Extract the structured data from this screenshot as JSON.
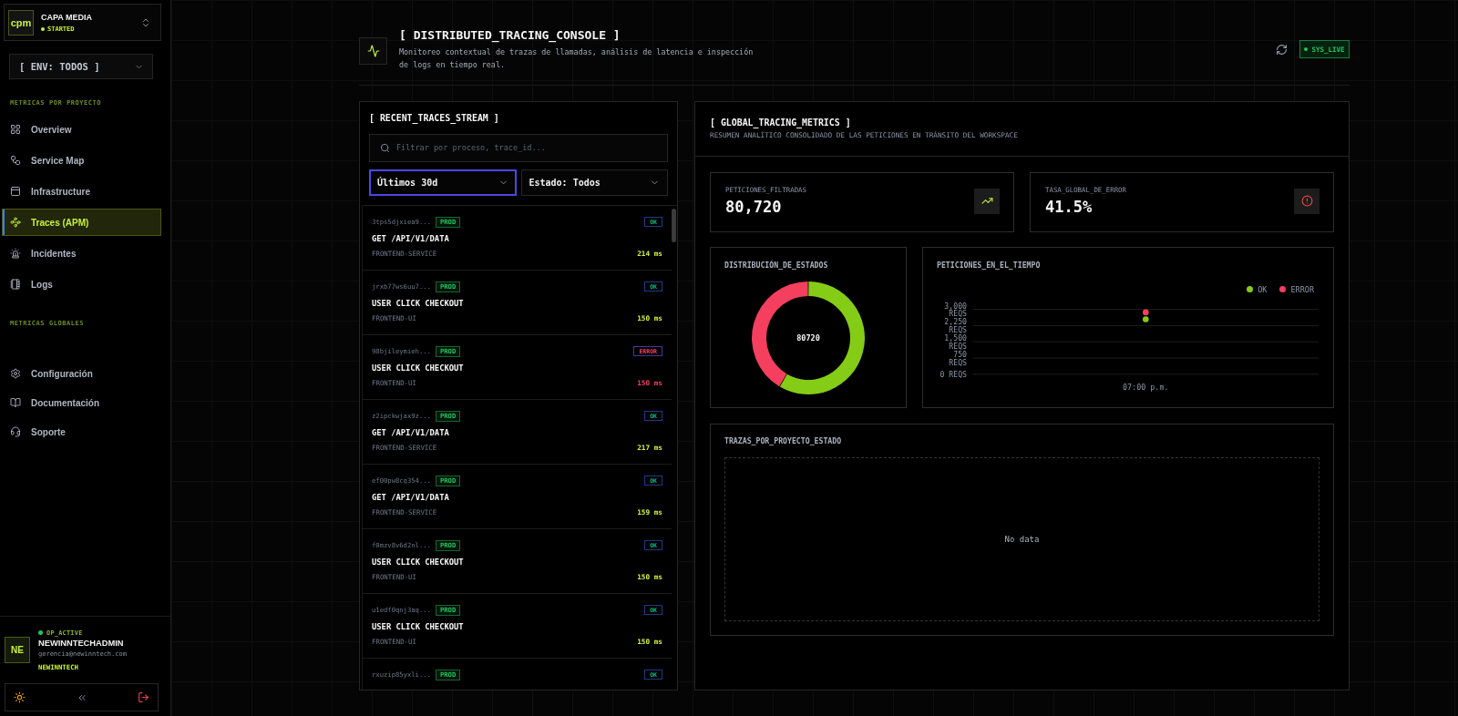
{
  "sidebar": {
    "workspace": {
      "logo": "cpm",
      "name": "CAPA MEDIA",
      "status": "STARTED"
    },
    "env_select": {
      "value": "[ ENV: TODOS ]"
    },
    "project_section": {
      "label": "METRICAS POR PROYECTO",
      "items": [
        {
          "label": "Overview",
          "selected": false
        },
        {
          "label": "Service Map",
          "selected": false
        },
        {
          "label": "Infrastructure",
          "selected": false
        },
        {
          "label": "Traces (APM)",
          "selected": true
        },
        {
          "label": "Incidentes",
          "selected": false
        },
        {
          "label": "Logs",
          "selected": false
        }
      ]
    },
    "global_section": {
      "label": "METRICAS GLOBALES"
    },
    "utility_items": [
      {
        "label": "Configuración"
      },
      {
        "label": "Documentación"
      },
      {
        "label": "Soporte"
      }
    ],
    "user": {
      "initials": "NE",
      "status": "OP_ACTIVE",
      "name": "NEWINNTECHADMIN",
      "email": "gerencia@newinntech.com",
      "org": "NEWINNTECH"
    }
  },
  "header": {
    "title": "[ DISTRIBUTED_TRACING_CONSOLE ]",
    "subtitle": "Monitoreo contextual de trazas de llamadas, análisis de latencia e inspección de logs en tiempo real.",
    "status_badge": "SYS_LIVE"
  },
  "traces_panel": {
    "title": "[ RECENT_TRACES_STREAM ]",
    "search": {
      "placeholder": "Filtrar por proceso, trace_id..."
    },
    "filters": [
      {
        "value": "Últimos 30d",
        "focused": true
      },
      {
        "value": "Estado: Todos",
        "focused": false
      }
    ],
    "traces": [
      {
        "id": "3tps5djxiea9...",
        "env": "PROD",
        "status": "OK",
        "kind": "ok",
        "name": "GET /API/V1/DATA",
        "service": "FRONTEND-SERVICE",
        "duration": "214 ms"
      },
      {
        "id": "jrxb77ws6uu7...",
        "env": "PROD",
        "status": "OK",
        "kind": "ok",
        "name": "USER CLICK CHECKOUT",
        "service": "FRONTEND-UI",
        "duration": "150 ms"
      },
      {
        "id": "98bjileymieh...",
        "env": "PROD",
        "status": "ERROR",
        "kind": "error",
        "name": "USER CLICK CHECKOUT",
        "service": "FRONTEND-UI",
        "duration": "150 ms"
      },
      {
        "id": "z2ipckwjax9z...",
        "env": "PROD",
        "status": "OK",
        "kind": "ok",
        "name": "GET /API/V1/DATA",
        "service": "FRONTEND-SERVICE",
        "duration": "217 ms"
      },
      {
        "id": "ef00pw8cq354...",
        "env": "PROD",
        "status": "OK",
        "kind": "ok",
        "name": "GET /API/V1/DATA",
        "service": "FRONTEND-SERVICE",
        "duration": "159 ms"
      },
      {
        "id": "f0mzv8v6d2nl...",
        "env": "PROD",
        "status": "OK",
        "kind": "ok",
        "name": "USER CLICK CHECKOUT",
        "service": "FRONTEND-UI",
        "duration": "150 ms"
      },
      {
        "id": "u1edf0qnj3aq...",
        "env": "PROD",
        "status": "OK",
        "kind": "ok",
        "name": "USER CLICK CHECKOUT",
        "service": "FRONTEND-UI",
        "duration": "150 ms"
      },
      {
        "id": "rxuzip85yxli...",
        "env": "PROD",
        "status": "OK",
        "kind": "ok"
      }
    ]
  },
  "metrics_panel": {
    "title": "[ GLOBAL_TRACING_METRICS ]",
    "subtitle": "RESUMEN ANALÍTICO CONSOLIDADO DE LAS PETICIONES EN TRÁNSITO DEL WORKSPACE",
    "stats": [
      {
        "label": "PETICIONES_FILTRADAS",
        "value": "80,720",
        "kind": "trend"
      },
      {
        "label": "TASA_GLOBAL_DE_ERROR",
        "value": "41.5%",
        "kind": "alert"
      }
    ],
    "status_chart": {
      "title": "DISTRIBUCIÓN_DE_ESTADOS",
      "center_label": "80720",
      "chart_data": {
        "type": "donut",
        "values": [
          58.5,
          41.5
        ],
        "colors": [
          "#84cc16",
          "#f43f5e"
        ]
      }
    },
    "time_chart": {
      "title": "PETICIONES_EN_EL_TIEMPO",
      "chart_data": {
        "type": "line",
        "categories": [
          "07:00 p.m."
        ],
        "series": [
          {
            "name": "OK",
            "color": "#84cc16",
            "values": [
              2540
            ],
            "marker": true
          },
          {
            "name": "ERROR",
            "color": "#f43f5e",
            "values": [
              2860
            ],
            "marker": true
          }
        ],
        "ylim": [
          0,
          3000
        ],
        "yticks": [
          {
            "value": 0,
            "label": "0 REQS"
          },
          {
            "value": 750,
            "label": "750 REQS"
          },
          {
            "value": 1500,
            "label": "1,500 REQS"
          },
          {
            "value": 2250,
            "label": "2,250 REQS"
          },
          {
            "value": 3000,
            "label": "3,000 REQS"
          }
        ],
        "grid": true
      }
    },
    "projects_chart": {
      "title": "TRAZAS_POR_PROYECTO_ESTADO",
      "empty_message": "No data"
    }
  }
}
